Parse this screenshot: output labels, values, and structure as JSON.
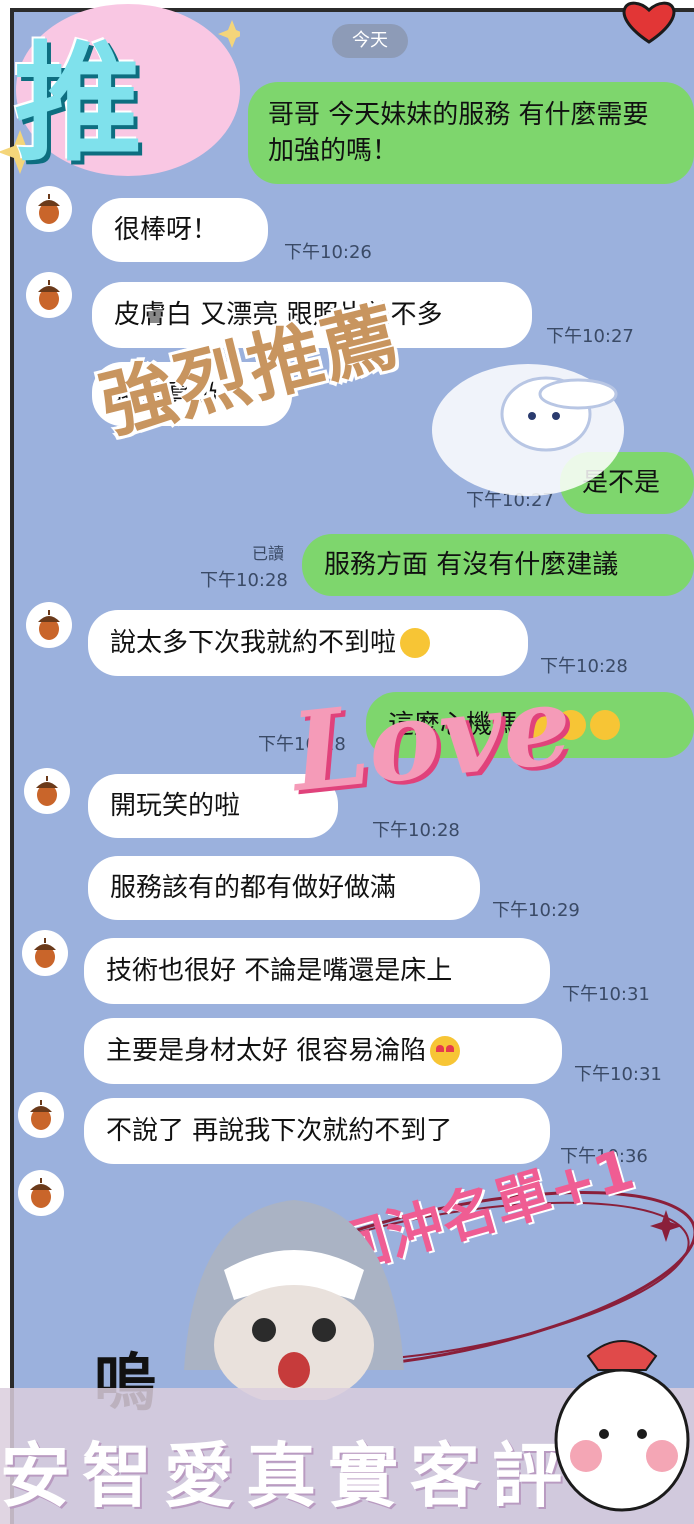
{
  "date_label": "今天",
  "read_label": "已讀",
  "messages": [
    {
      "text": "哥哥 今天妹妹的服務 有什麼需要加強的嗎！"
    },
    {
      "text": "很棒呀！",
      "time": "下午10:26"
    },
    {
      "text": "皮膚白 又漂亮 跟照片差不多",
      "time": "下午10:27"
    },
    {
      "text": "還是真奶！"
    },
    {
      "text": "是不是",
      "time": "下午10:27"
    },
    {
      "text": "服務方面 有沒有什麼建議",
      "time": "下午10:28"
    },
    {
      "text": "說太多下次我就約不到啦",
      "time": "下午10:28"
    },
    {
      "text": "這麼心機嗎",
      "time": "下午10:28"
    },
    {
      "text": "開玩笑的啦",
      "time": "下午10:28"
    },
    {
      "text": "服務該有的都有做好做滿",
      "time": "下午10:29"
    },
    {
      "text": "技術也很好 不論是嘴還是床上",
      "time": "下午10:31"
    },
    {
      "text": "主要是身材太好 很容易淪陷",
      "time": "下午10:31"
    },
    {
      "text": "不說了 再說我下次就約不到了",
      "time": "下午10:36"
    }
  ],
  "stickers": {
    "cheng": "推",
    "strong_recommend": "強烈推薦",
    "love": "Love",
    "repeat_list": "回沖名單+1",
    "wu": "嗚",
    "footer": "安智愛真實客評"
  },
  "colors": {
    "chat_bg": "#9bb1dd",
    "outgoing": "#7ed66d",
    "incoming": "#ffffff"
  }
}
